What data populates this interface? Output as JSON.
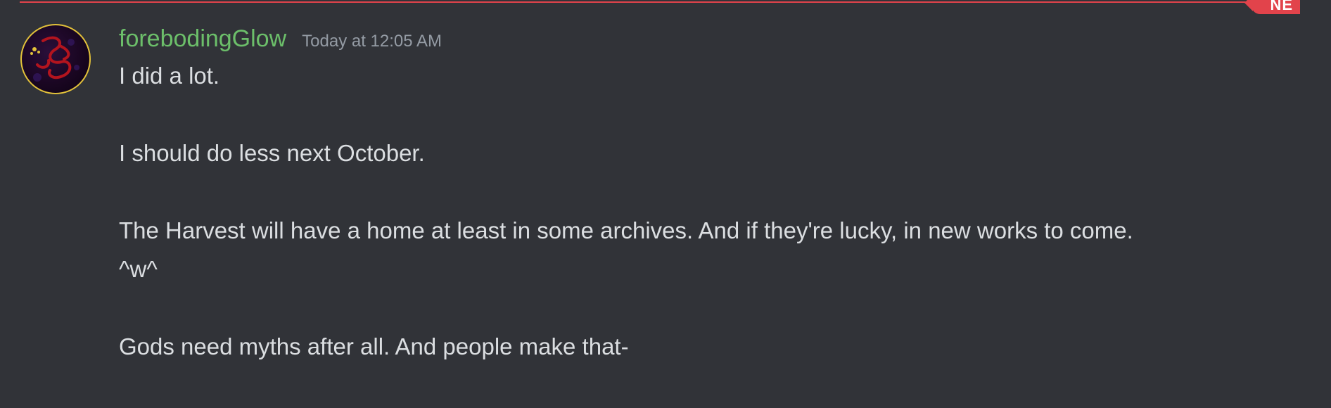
{
  "divider": {
    "badge_label": "NE",
    "accent_color": "#e2434b"
  },
  "message": {
    "username": "forebodingGlow",
    "username_color": "#6cbf6a",
    "timestamp": "Today at 12:05 AM",
    "lines": [
      "I did a lot.",
      "",
      "I should do less next October.",
      "",
      "The Harvest will have a home at least in some archives. And if they're lucky, in new works to come.",
      "^w^",
      "",
      "Gods need myths after all. And people make that-"
    ]
  },
  "avatar": {
    "icon": "serpent-avatar",
    "ring_color": "#e3c23a"
  }
}
